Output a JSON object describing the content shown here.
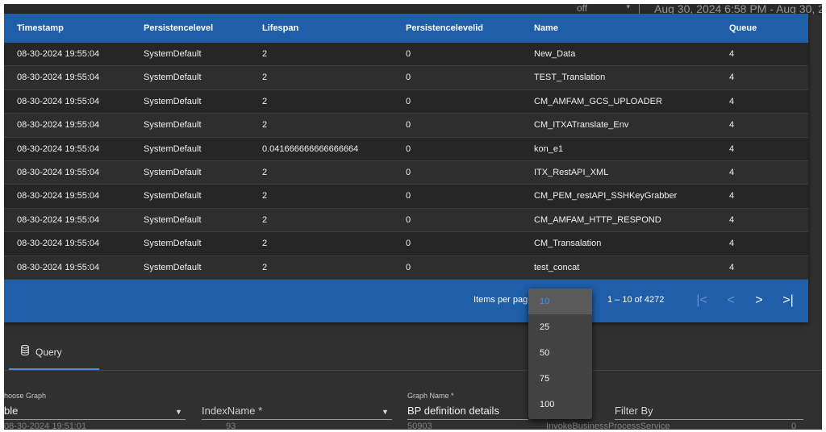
{
  "topbar": {
    "select_value": "off",
    "select_arrow": "▾",
    "date_range": "Aug 30, 2024 6:58 PM - Aug 30, 2024"
  },
  "table": {
    "headers": [
      "Timestamp",
      "Persistencelevel",
      "Lifespan",
      "Persistencelevelid",
      "Name",
      "Queue"
    ],
    "rows": [
      [
        "08-30-2024 19:55:04",
        "SystemDefault",
        "2",
        "0",
        "New_Data",
        "4"
      ],
      [
        "08-30-2024 19:55:04",
        "SystemDefault",
        "2",
        "0",
        "TEST_Translation",
        "4"
      ],
      [
        "08-30-2024 19:55:04",
        "SystemDefault",
        "2",
        "0",
        "CM_AMFAM_GCS_UPLOADER",
        "4"
      ],
      [
        "08-30-2024 19:55:04",
        "SystemDefault",
        "2",
        "0",
        "CM_ITXATranslate_Env",
        "4"
      ],
      [
        "08-30-2024 19:55:04",
        "SystemDefault",
        "0.041666666666666664",
        "0",
        "kon_e1",
        "4"
      ],
      [
        "08-30-2024 19:55:04",
        "SystemDefault",
        "2",
        "0",
        "ITX_RestAPI_XML",
        "4"
      ],
      [
        "08-30-2024 19:55:04",
        "SystemDefault",
        "2",
        "0",
        "CM_PEM_restAPI_SSHKeyGrabber",
        "4"
      ],
      [
        "08-30-2024 19:55:04",
        "SystemDefault",
        "2",
        "0",
        "CM_AMFAM_HTTP_RESPOND",
        "4"
      ],
      [
        "08-30-2024 19:55:04",
        "SystemDefault",
        "2",
        "0",
        "CM_Transalation",
        "4"
      ],
      [
        "08-30-2024 19:55:04",
        "SystemDefault",
        "2",
        "0",
        "test_concat",
        "4"
      ]
    ]
  },
  "paginator": {
    "items_per_page_label": "Items per pag",
    "range_label": "1 – 10 of 4272",
    "first": "|<",
    "prev": "<",
    "next": ">",
    "last": ">|",
    "options": [
      "10",
      "25",
      "50",
      "75",
      "100"
    ],
    "selected": "10"
  },
  "tabs": {
    "query_label": "Query"
  },
  "form": {
    "choose_graph_label": "hoose Graph",
    "choose_graph_value": "ble",
    "index_name_label": "IndexName *",
    "graph_name_label": "Graph Name *",
    "graph_name_value": "BP definition details",
    "filter_by_label": "Filter By"
  },
  "underlay": {
    "timestamp": "08-30-2024 19:51:01",
    "num1": "93",
    "num2": "50903",
    "service": "InvokeBusinessProcessService",
    "zero": "0"
  },
  "colors": {
    "header_blue": "#1f5ea8",
    "accent": "#4a90e2"
  }
}
